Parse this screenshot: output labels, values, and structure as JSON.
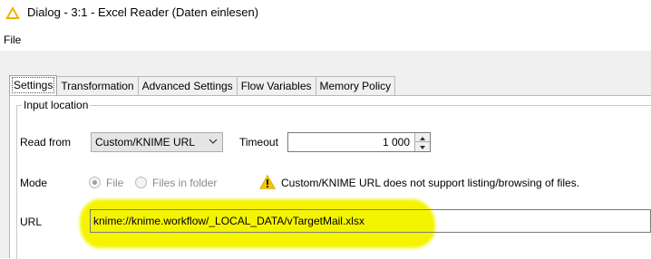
{
  "window": {
    "title": "Dialog - 3:1 - Excel Reader (Daten einlesen)",
    "icon": "warning-triangle-icon"
  },
  "menu": {
    "file": "File"
  },
  "tabs": [
    {
      "label": "Settings",
      "active": true
    },
    {
      "label": "Transformation",
      "active": false
    },
    {
      "label": "Advanced Settings",
      "active": false
    },
    {
      "label": "Flow Variables",
      "active": false
    },
    {
      "label": "Memory Policy",
      "active": false
    }
  ],
  "input_location": {
    "legend": "Input location",
    "read_from_label": "Read from",
    "read_from_value": "Custom/KNIME URL",
    "timeout_label": "Timeout",
    "timeout_value": "1 000",
    "mode_label": "Mode",
    "mode_options": [
      {
        "label": "File",
        "selected": true
      },
      {
        "label": "Files in folder",
        "selected": false
      }
    ],
    "warning_text": "Custom/KNIME URL does not support listing/browsing of files.",
    "url_label": "URL",
    "url_value": "knime://knime.workflow/_LOCAL_DATA/vTargetMail.xlsx"
  },
  "colors": {
    "highlight": "#f4f400",
    "warning": "#f5c400",
    "title_icon": "#f0b400"
  }
}
